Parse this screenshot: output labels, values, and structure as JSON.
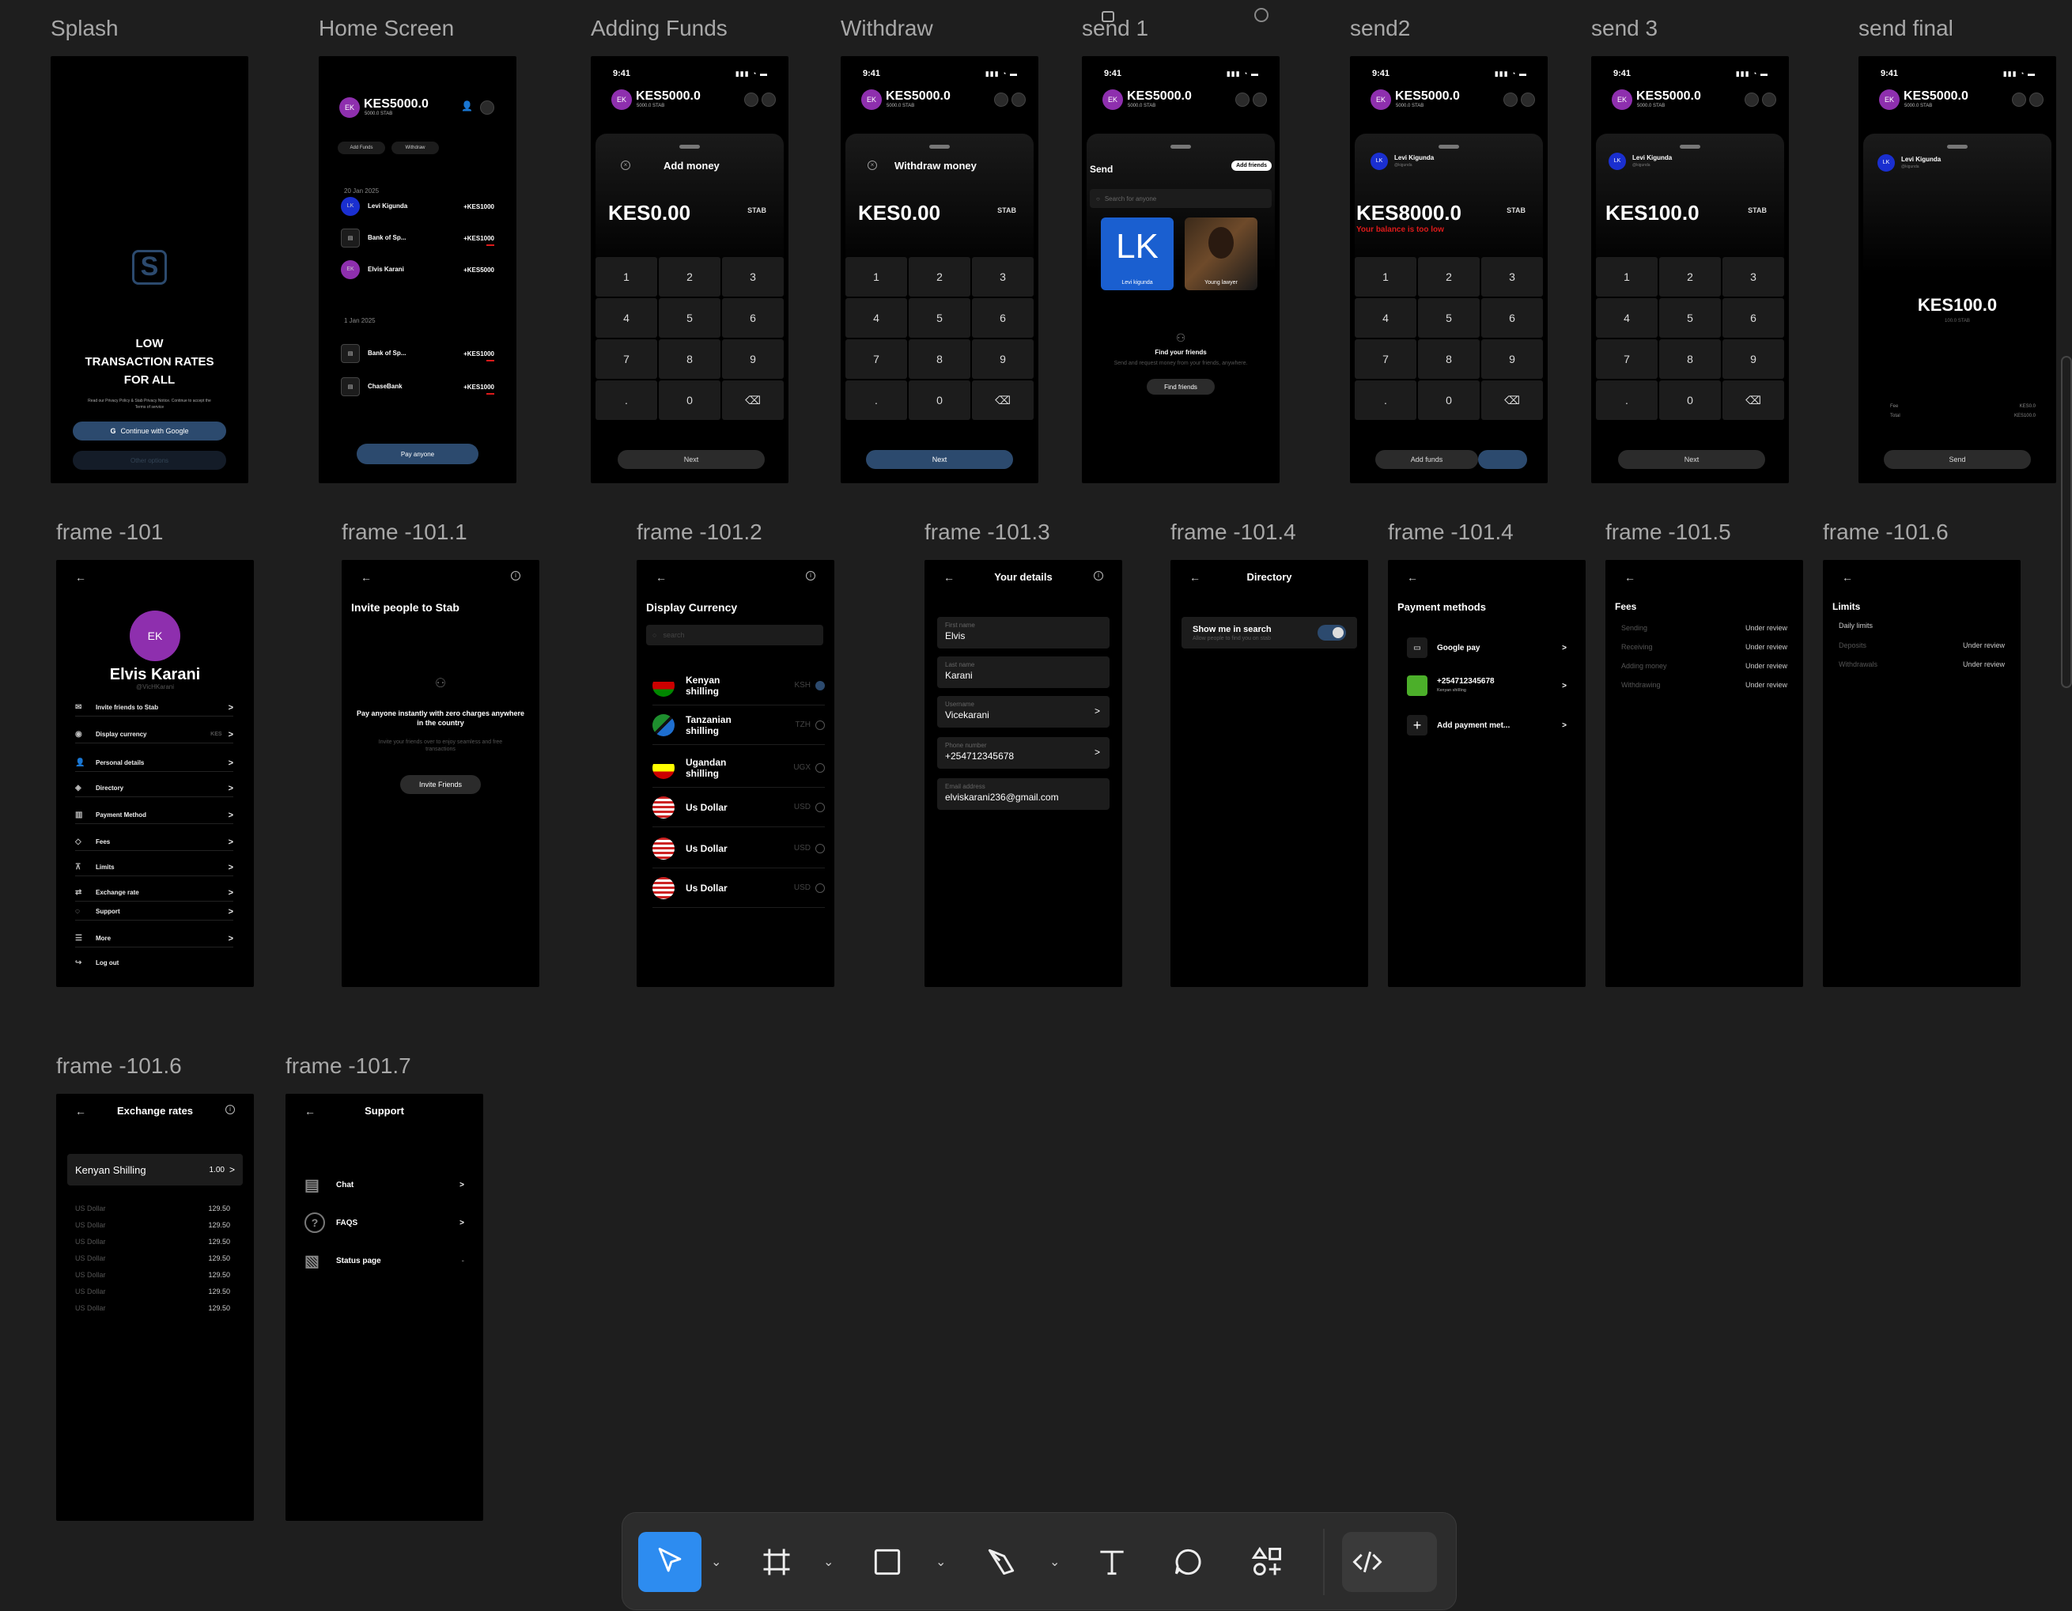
{
  "frame_titles": {
    "splash": "Splash",
    "home": "Home Screen",
    "adding": "Adding Funds",
    "withdraw": "Withdraw",
    "send1": "send 1",
    "send2": "send2",
    "send3": "send 3",
    "sendfinal": "send final",
    "f101": "frame -101",
    "f1011": "frame -101.1",
    "f1012": "frame -101.2",
    "f1013": "frame -101.3",
    "f1014a": "frame -101.4",
    "f1014b": "frame -101.4",
    "f1015": "frame -101.5",
    "f1016a": "frame -101.6",
    "f1016b": "frame -101.6",
    "f1017": "frame -101.7"
  },
  "common": {
    "time": "9:41",
    "status_icons": "▮▮▮ ◔ ▬",
    "avatar_initials": "EK",
    "balance": "KES5000.0",
    "balance_sub": "5000.0 STAB",
    "stab": "STAB",
    "lk": "LK",
    "levi": "Levi Kigunda",
    "levi_handle": "@kigunda"
  },
  "keypad": [
    "1",
    "2",
    "3",
    "4",
    "5",
    "6",
    "7",
    "8",
    "9",
    ".",
    "0",
    "⌫"
  ],
  "splash": {
    "headline": "LOW\nTRANSACTION RATES\nFOR ALL",
    "terms": "Read our Privacy Policy & Stab Privacy Notice. Continue to accept the Terms of service",
    "google": "Continue with Google",
    "other": "Other options"
  },
  "home": {
    "add_funds": "Add Funds",
    "withdraw": "Withdraw",
    "date1": "20 Jan 2025",
    "date2": "1 Jan 2025",
    "tx": [
      {
        "i": "LK",
        "n": "Levi Kigunda",
        "a": "+KES1000"
      },
      {
        "i": "▤",
        "n": "Bank of Sp...",
        "a": "+KES1000"
      },
      {
        "i": "EK",
        "n": "Elvis Karani",
        "a": "+KES5000"
      },
      {
        "i": "▤",
        "n": "Bank of Sp...",
        "a": "+KES1000"
      },
      {
        "i": "▤",
        "n": "ChaseBank",
        "a": "+KES1000"
      }
    ],
    "pay": "Pay anyone"
  },
  "add": {
    "title": "Add money",
    "amount": "KES0.00",
    "next": "Next"
  },
  "withdraw": {
    "title": "Withdraw money",
    "amount": "KES0.00",
    "next": "Next"
  },
  "send1": {
    "title": "Send",
    "add_friends": "Add friends",
    "search_ph": "Search for anyone",
    "card1_name": "Levi kigunda",
    "card2_name": "Young lawyer",
    "find_title": "Find your friends",
    "find_sub": "Send and request money from your friends, anywhere.",
    "find_btn": "Find friends"
  },
  "send2": {
    "amount": "KES8000.0",
    "error": "Your balance is too low",
    "add_funds": "Add funds"
  },
  "send3": {
    "amount": "KES100.0",
    "next": "Next"
  },
  "sendfinal": {
    "amount": "KES100.0",
    "sub": "100.0 STAB",
    "fee_k": "Fee",
    "fee_v": "KES0.0",
    "total_k": "Total",
    "total_v": "KES100.0",
    "send": "Send"
  },
  "profile": {
    "initials": "EK",
    "name": "Elvis Karani",
    "handle": "@VicHKarani",
    "items": [
      {
        "ic": "✉",
        "l": "Invite friends to Stab",
        "v": ""
      },
      {
        "ic": "◉",
        "l": "Display currency",
        "v": "KES"
      },
      {
        "ic": "👤",
        "l": "Personal details",
        "v": ""
      },
      {
        "ic": "◈",
        "l": "Directory",
        "v": ""
      },
      {
        "ic": "▥",
        "l": "Payment Method",
        "v": ""
      },
      {
        "ic": "◇",
        "l": "Fees",
        "v": ""
      },
      {
        "ic": "⊼",
        "l": "Limits",
        "v": ""
      },
      {
        "ic": "⇄",
        "l": "Exchange rate",
        "v": ""
      },
      {
        "ic": "◌",
        "l": "Support",
        "v": ""
      },
      {
        "ic": "☰",
        "l": "More",
        "v": ""
      }
    ],
    "logout": "Log out"
  },
  "invite": {
    "title": "Invite people to Stab",
    "headline": "Pay anyone instantly with zero charges anywhere in the country",
    "sub": "Invite your friends over to enjoy seamless and free transactions",
    "btn": "Invite Friends"
  },
  "currency": {
    "title": "Display Currency",
    "search_ph": "search",
    "items": [
      {
        "n": "Kenyan shilling",
        "c": "KSH"
      },
      {
        "n": "Tanzanian shilling",
        "c": "TZH"
      },
      {
        "n": "Ugandan shilling",
        "c": "UGX"
      },
      {
        "n": "Us Dollar",
        "c": "USD"
      },
      {
        "n": "Us Dollar",
        "c": "USD"
      },
      {
        "n": "Us Dollar",
        "c": "USD"
      }
    ]
  },
  "details": {
    "title": "Your details",
    "fields": [
      {
        "l": "First name",
        "v": "Elvis",
        "c": ""
      },
      {
        "l": "Last name",
        "v": "Karani",
        "c": ""
      },
      {
        "l": "Username",
        "v": "Vicekarani",
        "c": ">"
      },
      {
        "l": "Phone number",
        "v": "+254712345678",
        "c": ">"
      },
      {
        "l": "Email address",
        "v": "elviskarani236@gmail.com",
        "c": ""
      }
    ]
  },
  "directory": {
    "title": "Directory",
    "toggle_label": "Show me in search",
    "toggle_sub": "Allow people to find you on stab"
  },
  "payment": {
    "title": "Payment methods",
    "items": [
      {
        "l": "Google pay",
        "s": ""
      },
      {
        "l": "+254712345678",
        "s": "Kenyan shilling"
      },
      {
        "l": "Add payment met...",
        "s": ""
      }
    ]
  },
  "fees": {
    "title": "Fees",
    "rows": [
      {
        "k": "Sending",
        "v": "Under review"
      },
      {
        "k": "Receiving",
        "v": "Under review"
      },
      {
        "k": "Adding money",
        "v": "Under review"
      },
      {
        "k": "Withdrawing",
        "v": "Under review"
      }
    ]
  },
  "limits": {
    "title": "Limits",
    "daily": "Daily limits",
    "rows": [
      {
        "k": "Deposits",
        "v": "Under review"
      },
      {
        "k": "Withdrawals",
        "v": "Under review"
      }
    ]
  },
  "exchange": {
    "title": "Exchange rates",
    "selected": "Kenyan Shilling",
    "rate": "1.00",
    "rows": [
      {
        "k": "US Dollar",
        "v": "129.50"
      },
      {
        "k": "US Dollar",
        "v": "129.50"
      },
      {
        "k": "US Dollar",
        "v": "129.50"
      },
      {
        "k": "US Dollar",
        "v": "129.50"
      },
      {
        "k": "US Dollar",
        "v": "129.50"
      },
      {
        "k": "US Dollar",
        "v": "129.50"
      },
      {
        "k": "US Dollar",
        "v": "129.50"
      }
    ]
  },
  "support": {
    "title": "Support",
    "items": [
      {
        "l": "Chat",
        "c": ">"
      },
      {
        "l": "FAQS",
        "c": ">"
      },
      {
        "l": "Status page",
        "c": "-"
      }
    ]
  },
  "colors": {
    "canvas": "#1e1e1e",
    "accent_purple": "#8e2fae",
    "accent_blue": "#2563eb",
    "button_blue": "#2c4a6e",
    "error_red": "#dd1a1a",
    "tool_active": "#2d8cf0"
  },
  "toolbar": {
    "tools": [
      "move-tool",
      "frame-tool",
      "shape-tool",
      "pen-tool",
      "text-tool",
      "comment-tool",
      "actions-tool",
      "dev-mode-toggle"
    ]
  }
}
